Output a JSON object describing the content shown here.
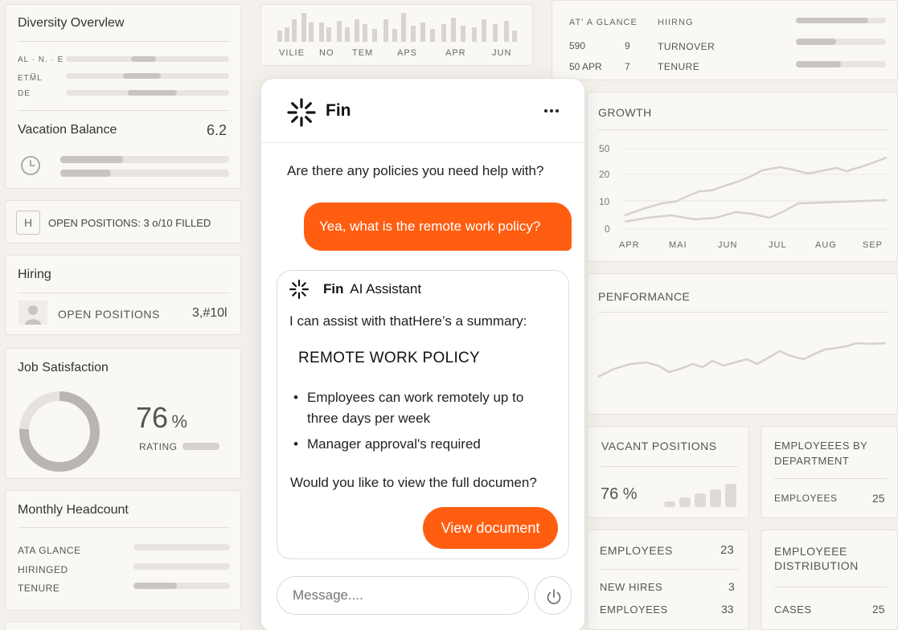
{
  "diversity": {
    "title": "Diversity Overvlew",
    "rows": [
      {
        "label": "AL · N. · E",
        "fill_start": 0.4,
        "fill_end": 0.55
      },
      {
        "label": "ETM̅L",
        "fill_start": 0.35,
        "fill_end": 0.58
      },
      {
        "label": "DE",
        "fill_start": 0.38,
        "fill_end": 0.68
      }
    ]
  },
  "vacation": {
    "title": "Vacation Balance",
    "value": "6.2",
    "icon": "clock-icon",
    "bars": [
      0.37,
      0.3
    ]
  },
  "open_positions_banner": {
    "icon_letter": "H",
    "text": "OPEN POSITIONS: 3 o/10 FILLED"
  },
  "hiring": {
    "title": "Hiring",
    "label": "OPEN POSITIONS",
    "value": "3,#10l"
  },
  "job_satisfaction": {
    "title": "Job Satisfaction",
    "value": "76",
    "unit": "%",
    "rating_label": "RATING",
    "fraction": 0.76
  },
  "monthly_headcount": {
    "title": "Monthly Headcount",
    "rows": [
      {
        "label": "ATA GLANCE",
        "fill": 0.0
      },
      {
        "label": "HIRINGED",
        "fill": 0.0
      },
      {
        "label": "TENURE",
        "fill": 0.45
      }
    ]
  },
  "top_chart": {
    "labels": [
      "VILIE",
      "NO",
      "TEM",
      "APS",
      "APR",
      "JUN"
    ]
  },
  "at_a_glance": {
    "col1_header": "AT' A GLANCE",
    "col2_header": "HIIRNG",
    "rows": [
      {
        "a": "590",
        "b": "9",
        "c": "TURNOVER",
        "fill": 0.45
      },
      {
        "a": "50 APR",
        "b": "7",
        "c": "TENURE",
        "fill": 0.5
      }
    ],
    "header_fill": 0.8
  },
  "growth": {
    "title": "GROWTH",
    "y_ticks": [
      "50",
      "20",
      "10",
      "0"
    ],
    "x_ticks": [
      "APR",
      "MAI",
      "JUN",
      "JUL",
      "AUG",
      "SEP"
    ]
  },
  "performance": {
    "title": "PENFORMANCE"
  },
  "vacant_positions": {
    "title": "VACANT POSITIONS",
    "value": "76 %",
    "bars": [
      0.2,
      0.35,
      0.5,
      0.65,
      0.85
    ]
  },
  "employees_by_dept": {
    "title": "EMPLOYEEES BY DEPARTMENT",
    "label": "EMPLOYEES",
    "value": "25"
  },
  "employees": {
    "title": "EMPLOYEES",
    "title_value": "23",
    "rows": [
      {
        "label": "NEW HIRES",
        "value": "3"
      },
      {
        "label": "EMPLOYEES",
        "value": "33"
      }
    ]
  },
  "distribution": {
    "title": "EMPLOYEEE DISTRIBUTION",
    "label": "CASES",
    "value": "25"
  },
  "chat": {
    "brand": "Fin",
    "menu_icon": "more-horizontal-icon",
    "prompt": "Are there any policies you need help with?",
    "user_message": "Yea, what is the remote work policy?",
    "assistant_name": "Fin",
    "assistant_role": "AI Assistant",
    "intro": "I can assist with thatHere’s a summary:",
    "policy_title": "REMOTE WORK POLICY",
    "bullets": [
      "Employees can work remotely up to three days per week",
      "Manager approval's required"
    ],
    "question": "Would you like to view the full documen?",
    "view_button": "View document",
    "input_placeholder": "Message....",
    "send_icon": "power-icon"
  },
  "colors": {
    "accent": "#ff5d10",
    "background": "#f4f1ec",
    "card": "#faf8f5"
  }
}
